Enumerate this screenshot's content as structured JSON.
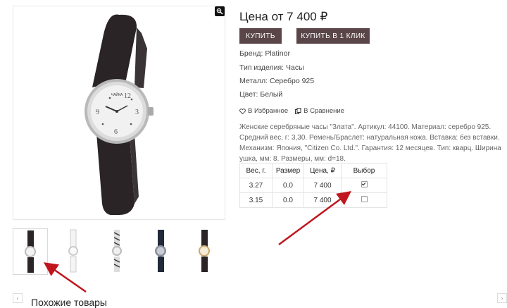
{
  "product": {
    "price_text": "Цена от 7 400 ₽",
    "buy_label": "Купить",
    "one_click_label": "Купить в 1 клик",
    "props": [
      {
        "key": "Бренд:",
        "value": "Platinor"
      },
      {
        "key": "Тип изделия:",
        "value": "Часы"
      },
      {
        "key": "Металл:",
        "value": "Серебро 925"
      },
      {
        "key": "Цвет:",
        "value": "Белый"
      }
    ],
    "favorites_label": "В Избранное",
    "compare_label": "В Сравнение",
    "description": "Женские серебряные часы \"Злата\". Артикул: 44100. Материал: серебро 925. Средний вес, г: 3,30. Ремень/Браслет: натуральная кожа. Вставка: без вставки. Механизм: Япония, \"Citizen Co. Ltd.\". Гарантия: 12 месяцев. Тип: кварц. Ширина ушка, мм: 8. Размеры, мм: d=18.",
    "watch_brand_text": "ЧАЙКА"
  },
  "table": {
    "headers": [
      "Вес, г.",
      "Размер",
      "Цена, ₽",
      "Выбор"
    ],
    "rows": [
      {
        "weight": "3.27",
        "size": "0.0",
        "price": "7 400",
        "checked": true
      },
      {
        "weight": "3.15",
        "size": "0.0",
        "price": "7 400",
        "checked": false
      }
    ]
  },
  "similar": {
    "title": "Похожие товары",
    "prev": "‹",
    "next": "›"
  },
  "thumbnails": [
    {
      "strap": "black",
      "active": true
    },
    {
      "strap": "white",
      "active": false
    },
    {
      "strap": "zebra",
      "active": false
    },
    {
      "strap": "black-blue-dial",
      "active": false
    },
    {
      "strap": "black-gold",
      "active": false
    }
  ],
  "colors": {
    "button_bg": "#5a4648",
    "arrow": "#c0161d"
  }
}
